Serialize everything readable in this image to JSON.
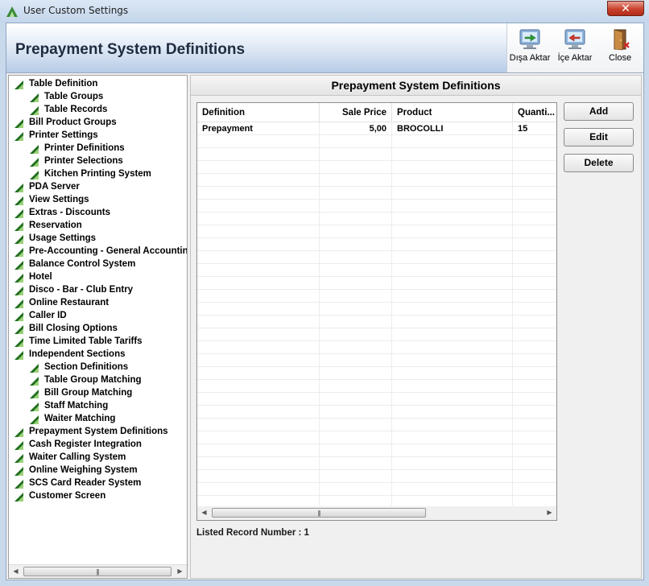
{
  "window": {
    "title": "User Custom Settings",
    "close_glyph": "✕"
  },
  "header": {
    "title": "Prepayment System Definitions"
  },
  "toolbar": [
    {
      "label": "Dışa Aktar",
      "icon": "export-monitor-icon"
    },
    {
      "label": "İçe Aktar",
      "icon": "import-monitor-icon"
    },
    {
      "label": "Close",
      "icon": "door-exit-icon"
    }
  ],
  "tree": {
    "items": [
      {
        "label": "Table Definition",
        "level": 0
      },
      {
        "label": "Table Groups",
        "level": 1
      },
      {
        "label": "Table Records",
        "level": 1
      },
      {
        "label": "Bill Product Groups",
        "level": 0
      },
      {
        "label": "Printer Settings",
        "level": 0
      },
      {
        "label": "Printer Definitions",
        "level": 1
      },
      {
        "label": "Printer Selections",
        "level": 1
      },
      {
        "label": "Kitchen Printing System",
        "level": 1
      },
      {
        "label": "PDA Server",
        "level": 0
      },
      {
        "label": "View Settings",
        "level": 0
      },
      {
        "label": "Extras - Discounts",
        "level": 0
      },
      {
        "label": "Reservation",
        "level": 0
      },
      {
        "label": "Usage Settings",
        "level": 0
      },
      {
        "label": "Pre-Accounting - General Accounting",
        "level": 0
      },
      {
        "label": "Balance Control System",
        "level": 0
      },
      {
        "label": "Hotel",
        "level": 0
      },
      {
        "label": "Disco - Bar - Club Entry",
        "level": 0
      },
      {
        "label": "Online Restaurant",
        "level": 0
      },
      {
        "label": "Caller ID",
        "level": 0
      },
      {
        "label": "Bill Closing Options",
        "level": 0
      },
      {
        "label": "Time Limited Table Tariffs",
        "level": 0
      },
      {
        "label": "Independent Sections",
        "level": 0
      },
      {
        "label": "Section Definitions",
        "level": 1
      },
      {
        "label": "Table Group Matching",
        "level": 1
      },
      {
        "label": "Bill Group Matching",
        "level": 1
      },
      {
        "label": "Staff Matching",
        "level": 1
      },
      {
        "label": "Waiter Matching",
        "level": 1
      },
      {
        "label": "Prepayment System Definitions",
        "level": 0
      },
      {
        "label": "Cash Register Integration",
        "level": 0
      },
      {
        "label": "Waiter Calling System",
        "level": 0
      },
      {
        "label": "Online Weighing System",
        "level": 0
      },
      {
        "label": "SCS Card Reader System",
        "level": 0
      },
      {
        "label": "Customer Screen",
        "level": 0
      }
    ]
  },
  "content": {
    "title": "Prepayment System Definitions",
    "columns": [
      "Definition",
      "Sale Price",
      "Product",
      "Quanti..."
    ],
    "rows": [
      [
        "Prepayment",
        "5,00",
        "BROCOLLI",
        "15"
      ]
    ],
    "empty_rows": 29,
    "buttons": {
      "add": "Add",
      "edit": "Edit",
      "delete": "Delete"
    },
    "status": "Listed Record Number : 1"
  },
  "scrollbar": {
    "left_arrow": "◀",
    "right_arrow": "▶",
    "grip": "|||"
  },
  "colors": {
    "tree_icon_dark": "#1f6d1f",
    "tree_icon_light": "#9bd17a",
    "header_text": "#1f2c40"
  }
}
